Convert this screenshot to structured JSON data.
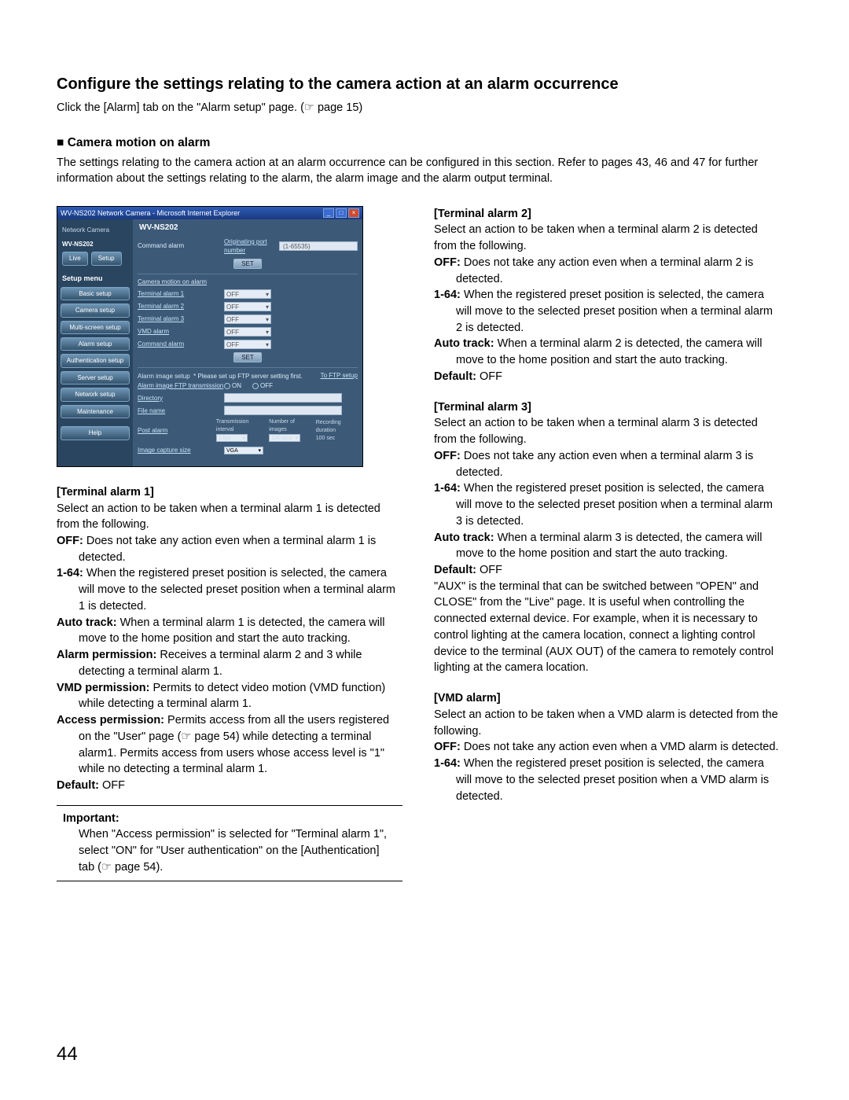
{
  "section_title": "Configure the settings relating to the camera action at an alarm occurrence",
  "intro_line": "Click the [Alarm] tab on the \"Alarm setup\" page. (☞ page 15)",
  "sub_heading_marker": "■",
  "sub_heading": "Camera motion on alarm",
  "sub_intro": "The settings relating to the camera action at an alarm occurrence can be configured in this section. Refer to pages 43, 46 and 47 for further information about the settings relating to the alarm, the alarm image and the alarm output terminal.",
  "page_number": "44",
  "screenshot": {
    "window_title": "WV-NS202 Network Camera - Microsoft Internet Explorer",
    "crumb_label": "Network Camera",
    "crumb_model": "WV-NS202",
    "model_heading": "WV-NS202",
    "btn_live": "Live",
    "btn_setup": "Setup",
    "menu_title": "Setup menu",
    "menu_items": [
      "Basic setup",
      "Camera setup",
      "Multi-screen setup",
      "Alarm setup",
      "Authentication setup",
      "Server setup",
      "Network setup",
      "Maintenance",
      "Help"
    ],
    "top_row_label": "Command alarm",
    "top_row_sub": "Originating port number",
    "top_row_value": "(1-65535)",
    "set_btn": "SET",
    "panel1_head": "Camera motion on alarm",
    "motion_rows": [
      "Terminal alarm 1",
      "Terminal alarm 2",
      "Terminal alarm 3",
      "VMD alarm",
      "Command alarm"
    ],
    "select_val": "OFF",
    "panel2_head1": "Alarm image setup",
    "panel2_note": "* Please set up FTP server setting first.",
    "panel2_rightlink": "To FTP setup",
    "row_ftp": "Alarm image FTP transmission",
    "radio_on": "ON",
    "radio_off": "OFF",
    "row_dir": "Directory",
    "row_file": "File name",
    "row_post": "Post alarm",
    "post_col1": "Transmission interval",
    "post_col2": "Number of images",
    "post_col3": "Recording duration",
    "post_val1": "1 fps",
    "post_val2": "100 pics",
    "post_val3": "100 sec",
    "row_ics": "Image capture size",
    "ics_val": "VGA"
  },
  "left": {
    "t1_title": "[Terminal alarm 1]",
    "t1_intro": "Select an action to be taken when a terminal alarm 1 is detected from the following.",
    "opts": {
      "off_l": "OFF:",
      "off_t": " Does not take any action even when a terminal alarm 1 is detected.",
      "r164_l": "1-64:",
      "r164_t": " When the registered preset position is selected, the camera will move to the selected preset position when a terminal alarm 1 is detected.",
      "auto_l": "Auto track:",
      "auto_t": " When a terminal alarm 1 is detected, the camera will move to the home position and start the auto tracking.",
      "ap_l": "Alarm permission:",
      "ap_t": " Receives a terminal alarm 2 and 3 while detecting a terminal alarm 1.",
      "vp_l": "VMD permission:",
      "vp_t": " Permits to detect video motion (VMD function) while detecting a terminal alarm 1.",
      "acc_l": "Access permission:",
      "acc_t": " Permits access from all the users registered on the \"User\" page (☞ page 54) while detecting a terminal alarm1. Permits access from users whose access level is \"1\" while no detecting a terminal alarm 1."
    },
    "default_l": "Default:",
    "default_v": " OFF",
    "imp_title": "Important:",
    "imp_body": "When \"Access permission\" is selected for \"Terminal alarm 1\", select \"ON\" for \"User authentication\" on the [Authentication] tab (☞ page 54)."
  },
  "right": {
    "t2_title": "[Terminal alarm 2]",
    "t2_intro": "Select an action to be taken when a terminal alarm 2 is detected from the following.",
    "t2": {
      "off_l": "OFF:",
      "off_t": " Does not take any action even when a terminal alarm 2 is detected.",
      "r164_l": "1-64:",
      "r164_t": " When the registered preset position is selected, the camera will move to the selected preset position when a terminal alarm 2 is detected.",
      "auto_l": "Auto track:",
      "auto_t": " When a terminal alarm 2 is detected, the camera will move to the home position and start the auto tracking."
    },
    "t2_default_l": "Default:",
    "t2_default_v": " OFF",
    "t3_title": "[Terminal alarm 3]",
    "t3_intro": "Select an action to be taken when a terminal alarm 3 is detected from the following.",
    "t3": {
      "off_l": "OFF:",
      "off_t": " Does not take any action even when a terminal alarm 3 is detected.",
      "r164_l": "1-64:",
      "r164_t": " When the registered preset position is selected, the camera will move to the selected preset position when a terminal alarm 3 is detected.",
      "auto_l": "Auto track:",
      "auto_t": " When a terminal alarm 3 is detected, the camera will move to the home position and start the auto tracking."
    },
    "t3_default_l": "Default:",
    "t3_default_v": " OFF",
    "aux_para": "\"AUX\" is the terminal that can be switched between \"OPEN\" and CLOSE\" from the \"Live\" page. It is useful when controlling the connected external device. For example, when it is necessary to control lighting at the camera location, connect a lighting control device to the terminal (AUX OUT) of the camera to remotely control lighting at the camera location.",
    "vmd_title": "[VMD alarm]",
    "vmd_intro": "Select an action to be taken when a VMD alarm is detected from the following.",
    "vmd": {
      "off_l": "OFF:",
      "off_t": " Does not take any action even when a VMD alarm is detected.",
      "r164_l": "1-64:",
      "r164_t": " When the registered preset position is selected, the camera will move to the selected preset position when a VMD alarm is detected."
    }
  }
}
